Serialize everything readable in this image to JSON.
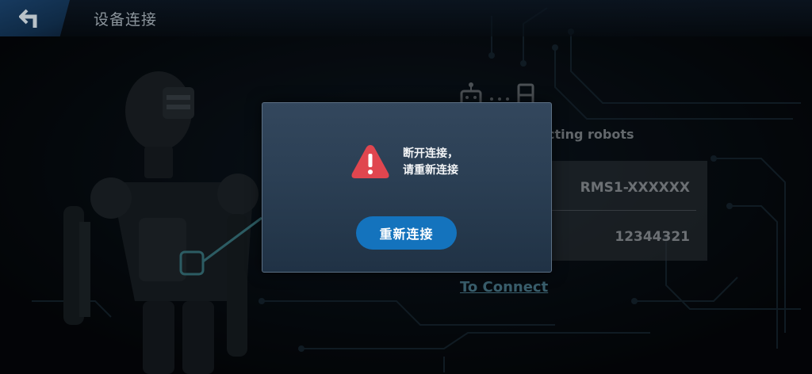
{
  "header": {
    "title": "设备连接",
    "back_icon": "back-arrow-icon"
  },
  "robot_panel": {
    "status_text": "cting robots",
    "device_name": "RMS1-XXXXXX",
    "device_id": "12344321",
    "connect_link": "To Connect",
    "icons": [
      "robot-icon",
      "device-icon"
    ]
  },
  "dialog": {
    "icon": "warning-triangle-icon",
    "message_line1": "断开连接，",
    "message_line2": "请重新连接",
    "button_label": "重新连接"
  },
  "colors": {
    "accent": "#1473bd",
    "warning": "#e0464f",
    "link": "#5f9db5",
    "dialog_top": "#33475d",
    "dialog_bottom": "#203245"
  }
}
